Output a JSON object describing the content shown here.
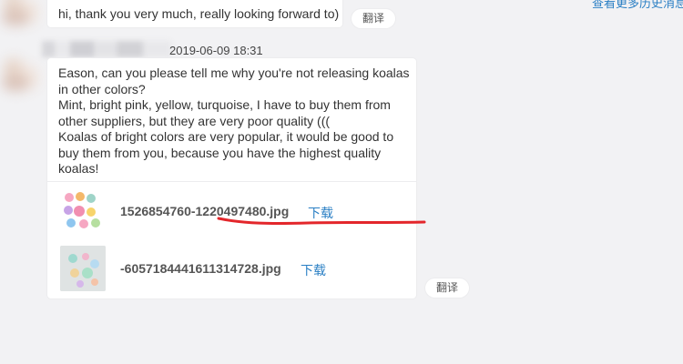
{
  "prev_message": {
    "text": "hi, thank you very much, really looking forward to)",
    "translate_label": "翻译"
  },
  "top_link": {
    "text": "查看更多历史消息"
  },
  "message": {
    "timestamp": "2019-06-09 18:31",
    "lines": [
      "Eason, can you please tell me why you're not releasing koalas",
      "in other colors?",
      "Mint, bright pink, yellow, turquoise, I have to buy them from",
      "other suppliers, but they are very poor quality (((",
      "Koalas of bright colors are very popular, it would be good to",
      "buy them from you, because you have the highest quality",
      "koalas!"
    ],
    "attachments": [
      {
        "filename": "1526854760-1220497480.jpg",
        "download_label": "下载"
      },
      {
        "filename": "-6057184441611314728.jpg",
        "download_label": "下载"
      }
    ],
    "translate_label": "翻译"
  },
  "colors": {
    "background": "#f2f2f4",
    "link": "#2a7fc4",
    "underline_annotation": "#e3262b"
  }
}
